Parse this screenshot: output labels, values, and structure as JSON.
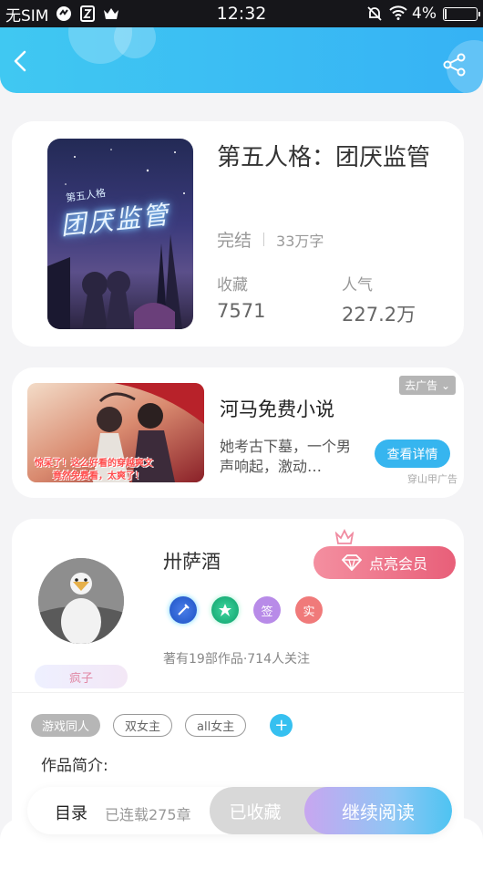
{
  "status_bar": {
    "carrier": "无SIM",
    "time": "12:32",
    "battery": "4%"
  },
  "book": {
    "title": "第五人格：团厌监管",
    "cover_text": "团厌监管",
    "cover_subtitle": "第五人格",
    "status": "完结",
    "word_count": "33万字",
    "favorites_label": "收藏",
    "favorites_value": "7571",
    "popularity_label": "人气",
    "popularity_value": "227.2万"
  },
  "ad": {
    "tag": "去广告",
    "title": "河马免费小说",
    "description": "她考古下墓，一个男声响起，激动…",
    "button": "查看详情",
    "source": "穿山甲广告",
    "image_text_line1": "惊呆了！这么好看的穿越爽文",
    "image_text_line2": "竟然免费看，太爽了！"
  },
  "author": {
    "name": "卅萨酒",
    "vip_button": "点亮会员",
    "rank": "疯子",
    "badge_sign": "签",
    "badge_real": "实",
    "stats": "著有19部作品·714人关注"
  },
  "tags": [
    "游戏同人",
    "双女主",
    "all女主"
  ],
  "intro_label": "作品简介:",
  "bottom_bar": {
    "toc": "目录",
    "chapters": "已连载275章",
    "collected": "已收藏",
    "continue": "继续阅读"
  },
  "colors": {
    "header": "#36b2f4",
    "accent": "#36b5ef",
    "vip": "#e85f79"
  }
}
